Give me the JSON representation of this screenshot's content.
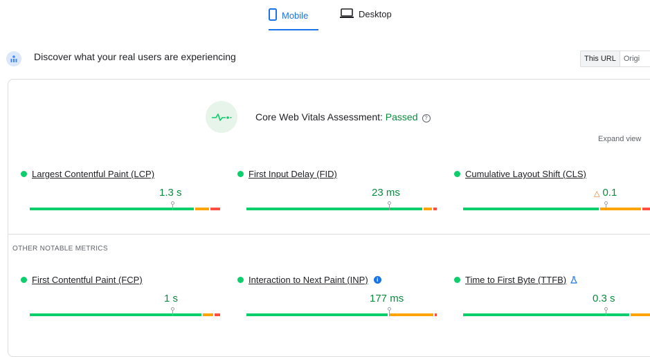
{
  "tabs": [
    {
      "label": "Mobile",
      "icon": "mobile-icon",
      "active": true
    },
    {
      "label": "Desktop",
      "icon": "desktop-icon",
      "active": false
    }
  ],
  "header": {
    "title": "Discover what your real users are experiencing",
    "icon": "field-data-icon",
    "toggle": {
      "active": "This URL",
      "other": "Origi"
    }
  },
  "assessment": {
    "label": "Core Web Vitals Assessment: ",
    "status": "Passed",
    "help_glyph": "?",
    "expand_label": "Expand view",
    "icon": "pulse-icon"
  },
  "core_metrics": [
    {
      "name": "Largest Contentful Paint (LCP)",
      "value": "1.3 s",
      "distribution": {
        "good": 0.87,
        "needs_improvement": 0.08,
        "poor": 0.05
      }
    },
    {
      "name": "First Input Delay (FID)",
      "value": "23 ms",
      "distribution": {
        "good": 0.93,
        "needs_improvement": 0.05,
        "poor": 0.02
      }
    },
    {
      "name": "Cumulative Layout Shift (CLS)",
      "value": "0.1",
      "value_icon": "warning-triangle-icon",
      "distribution": {
        "good": 0.72,
        "needs_improvement": 0.22,
        "poor": 0.06
      }
    }
  ],
  "other_label": "OTHER NOTABLE METRICS",
  "other_metrics": [
    {
      "name": "First Contentful Paint (FCP)",
      "value": "1 s",
      "distribution": {
        "good": 0.91,
        "needs_improvement": 0.06,
        "poor": 0.03
      }
    },
    {
      "name": "Interaction to Next Paint (INP)",
      "value": "177 ms",
      "icon": "info-icon",
      "info_glyph": "i",
      "distribution": {
        "good": 0.75,
        "needs_improvement": 0.24,
        "poor": 0.01
      }
    },
    {
      "name": "Time to First Byte (TTFB)",
      "value": "0.3 s",
      "icon": "experimental-flask-icon",
      "distribution": {
        "good": 0.88,
        "needs_improvement": 0.11,
        "poor": 0.01
      }
    }
  ],
  "colors": {
    "good": "#0cce6b",
    "needs_improvement": "#ffa400",
    "poor": "#ff4e42",
    "accent": "#1a73e8",
    "passed_text": "#0a8a3f"
  }
}
